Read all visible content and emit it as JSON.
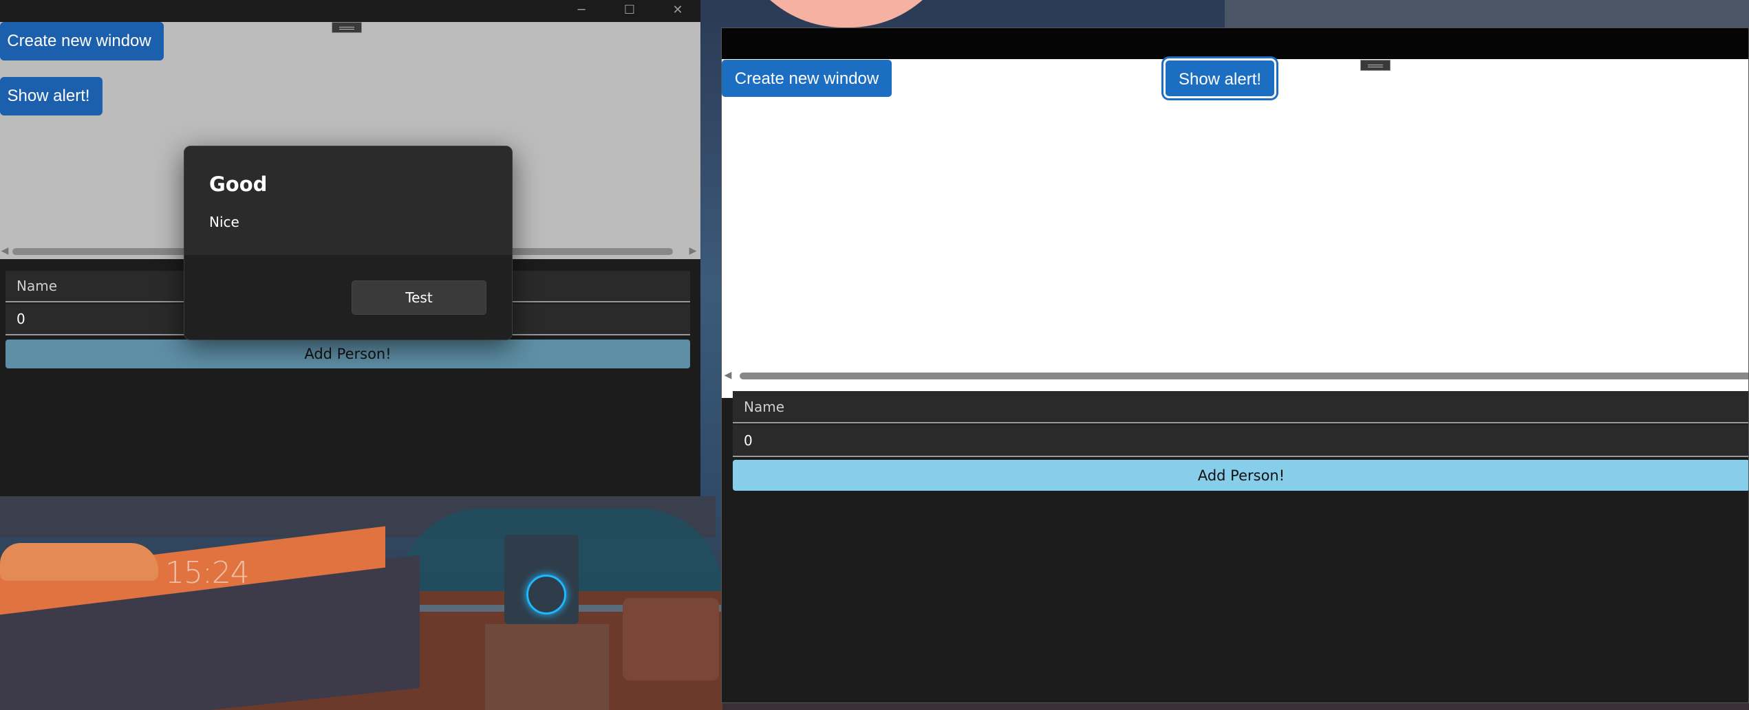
{
  "wallpaper": {
    "clock": "15:24"
  },
  "window_left": {
    "caption": {
      "minimize": "─",
      "maximize": "☐",
      "close": "✕"
    },
    "buttons": {
      "create_window": "Create new window",
      "show_alert": "Show alert!"
    },
    "form": {
      "name_placeholder": "Name",
      "number_value": "0",
      "add_person": "Add Person!"
    },
    "dialog": {
      "title": "Good",
      "message": "Nice",
      "button": "Test"
    },
    "scroll": {
      "left_arrow": "◀",
      "right_arrow": "▶"
    }
  },
  "window_right": {
    "buttons": {
      "create_window": "Create new window",
      "show_alert": "Show alert!"
    },
    "form": {
      "name_placeholder": "Name",
      "number_value": "0",
      "add_person": "Add Person!"
    },
    "scroll": {
      "left_arrow": "◀"
    }
  },
  "colors": {
    "button_blue": "#1b6ec2",
    "add_person_bg": "#87ceeb",
    "add_person_bg_dimmed": "#5e8fa6",
    "window_bg": "#1c1c1c",
    "dialog_bg": "#2b2b2b",
    "focus_ring": "#1b6ec2"
  }
}
